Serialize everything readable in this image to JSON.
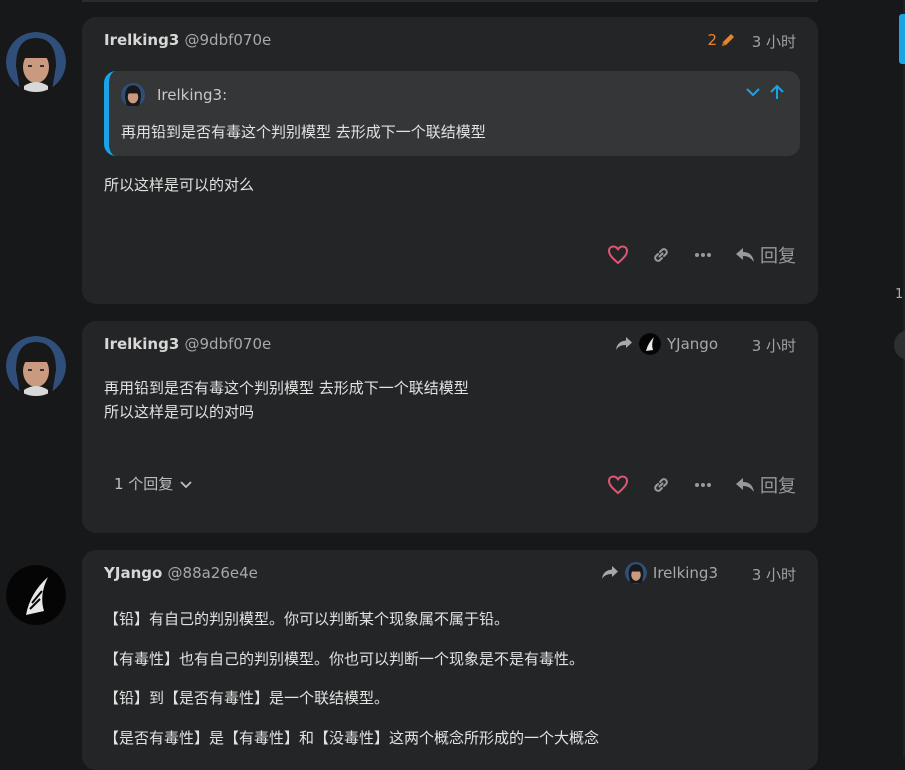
{
  "colors": {
    "accent": "#1aa3e6",
    "edit": "#e8862a",
    "heart": "#e05573"
  },
  "posts": [
    {
      "username": "Irelking3",
      "handle": "@9dbf070e",
      "edit_count": "2",
      "time": "3 小时",
      "quote": {
        "username": "Irelking3:",
        "text": "再用铅到是否有毒这个判别模型 去形成下一个联结模型"
      },
      "body": "所以这样是可以的对么",
      "reply_label": "回复"
    },
    {
      "username": "Irelking3",
      "handle": "@9dbf070e",
      "reply_to": "YJango",
      "time": "3 小时",
      "body_lines": [
        "再用铅到是否有毒这个判别模型 去形成下一个联结模型",
        "所以这样是可以的对吗"
      ],
      "replies_toggle": "1 个回复",
      "reply_label": "回复"
    },
    {
      "username": "YJango",
      "handle": "@88a26e4e",
      "reply_to": "Irelking3",
      "time": "3 小时",
      "paragraphs": [
        "【铅】有自己的判别模型。你可以判断某个现象属不属于铅。",
        "【有毒性】也有自己的判别模型。你也可以判断一个现象是不是有毒性。",
        "【铅】到【是否有毒性】是一个联结模型。",
        "【是否有毒性】是【有毒性】和【没毒性】这两个概念所形成的一个大概念"
      ]
    }
  ],
  "edge": {
    "text": "1"
  }
}
